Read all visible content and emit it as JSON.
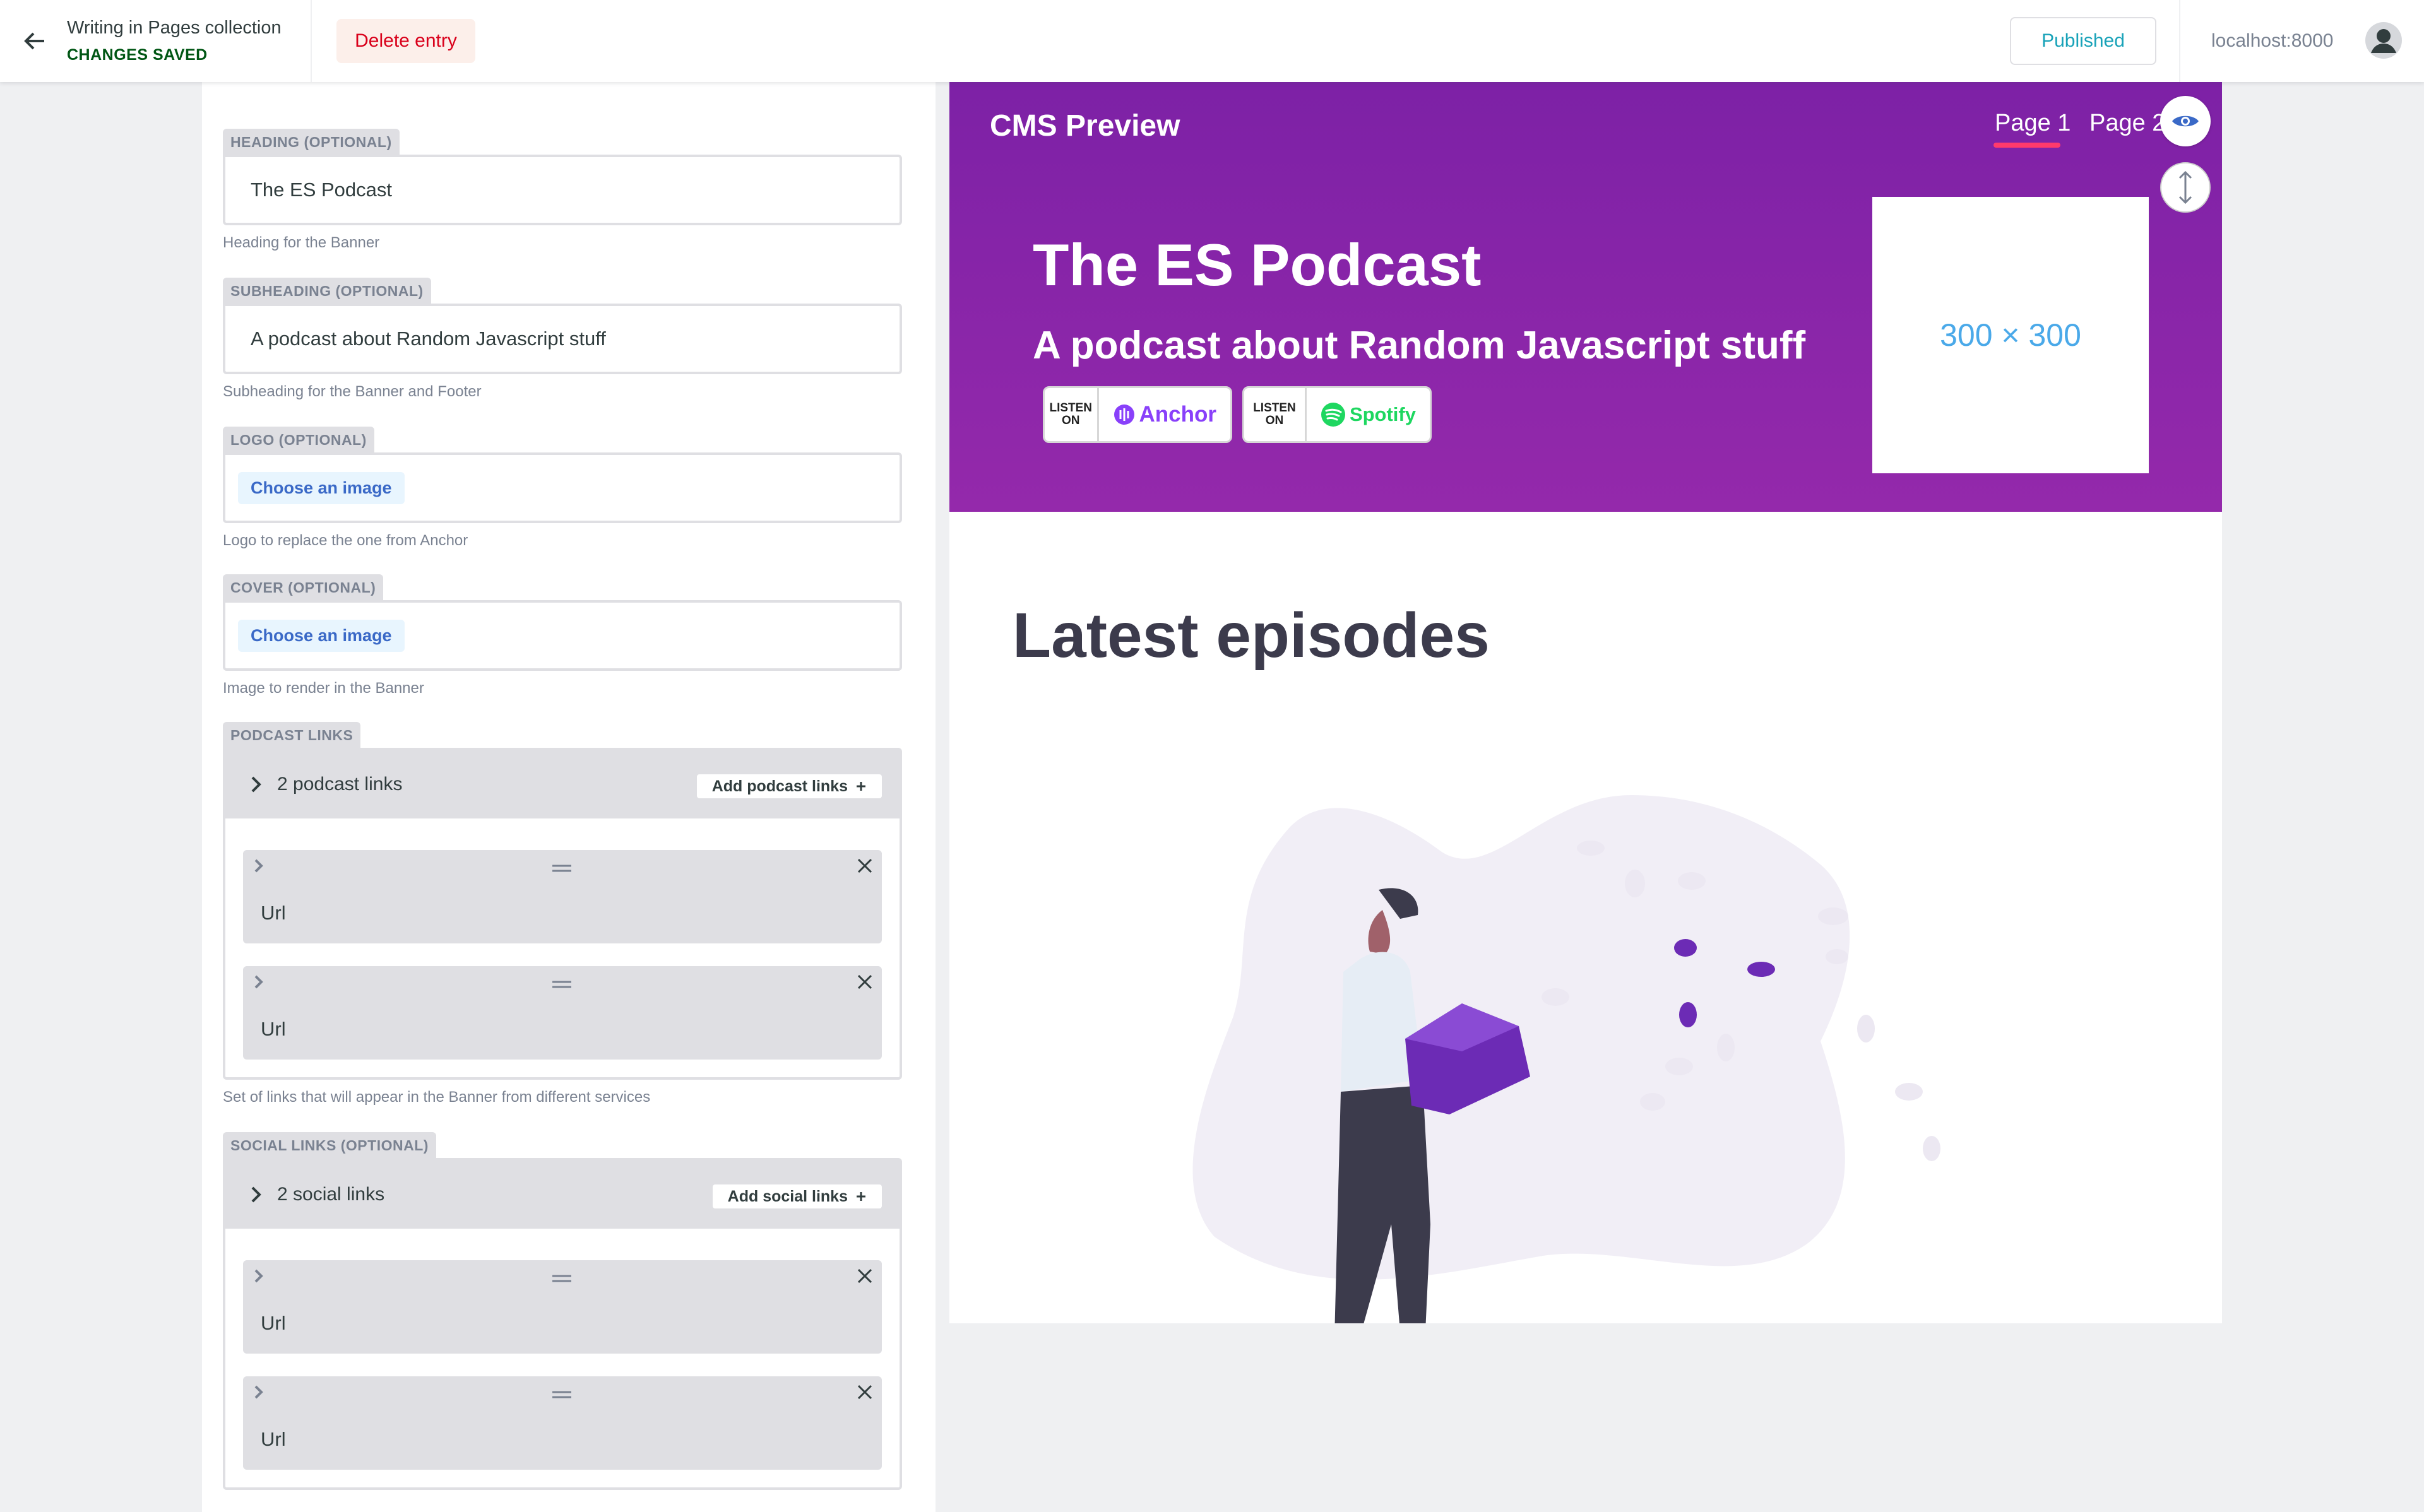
{
  "topbar": {
    "collection_title": "Writing in Pages collection",
    "save_status": "CHANGES SAVED",
    "delete_label": "Delete entry",
    "publish_label": "Published",
    "host": "localhost:8000"
  },
  "editor": {
    "heading": {
      "label": "HEADING (OPTIONAL)",
      "value": "The ES Podcast",
      "hint": "Heading for the Banner"
    },
    "subheading": {
      "label": "SUBHEADING (OPTIONAL)",
      "value": "A podcast about Random Javascript stuff",
      "hint": "Subheading for the Banner and Footer"
    },
    "logo": {
      "label": "LOGO (OPTIONAL)",
      "button": "Choose an image",
      "hint": "Logo to replace the one from Anchor"
    },
    "cover": {
      "label": "COVER (OPTIONAL)",
      "button": "Choose an image",
      "hint": "Image to render in the Banner"
    },
    "podcast_links": {
      "label": "PODCAST LINKS",
      "count": "2 podcast links",
      "add_label": "Add podcast links",
      "items": [
        {
          "label": "Url"
        },
        {
          "label": "Url"
        }
      ],
      "hint": "Set of links that will appear in the Banner from different services"
    },
    "social_links": {
      "label": "SOCIAL LINKS (OPTIONAL)",
      "count": "2 social links",
      "add_label": "Add social links",
      "items": [
        {
          "label": "Url"
        },
        {
          "label": "Url"
        }
      ]
    }
  },
  "preview": {
    "brand": "CMS Preview",
    "nav": [
      "Page 1",
      "Page 2"
    ],
    "banner_title": "The ES Podcast",
    "banner_subtitle": "A podcast about Random Javascript stuff",
    "badges": [
      {
        "listen": "LISTEN",
        "on": "ON",
        "service": "Anchor",
        "color": "#8940fa"
      },
      {
        "listen": "LISTEN",
        "on": "ON",
        "service": "Spotify",
        "color": "#1ed760"
      }
    ],
    "cover_placeholder": "300 × 300",
    "section_title": "Latest episodes",
    "colors": {
      "banner_top": "#7d21a6",
      "banner_bottom": "#9429ab",
      "nav_underline": "#ff3a6c",
      "illustration_accent": "#6c2bb5"
    }
  }
}
